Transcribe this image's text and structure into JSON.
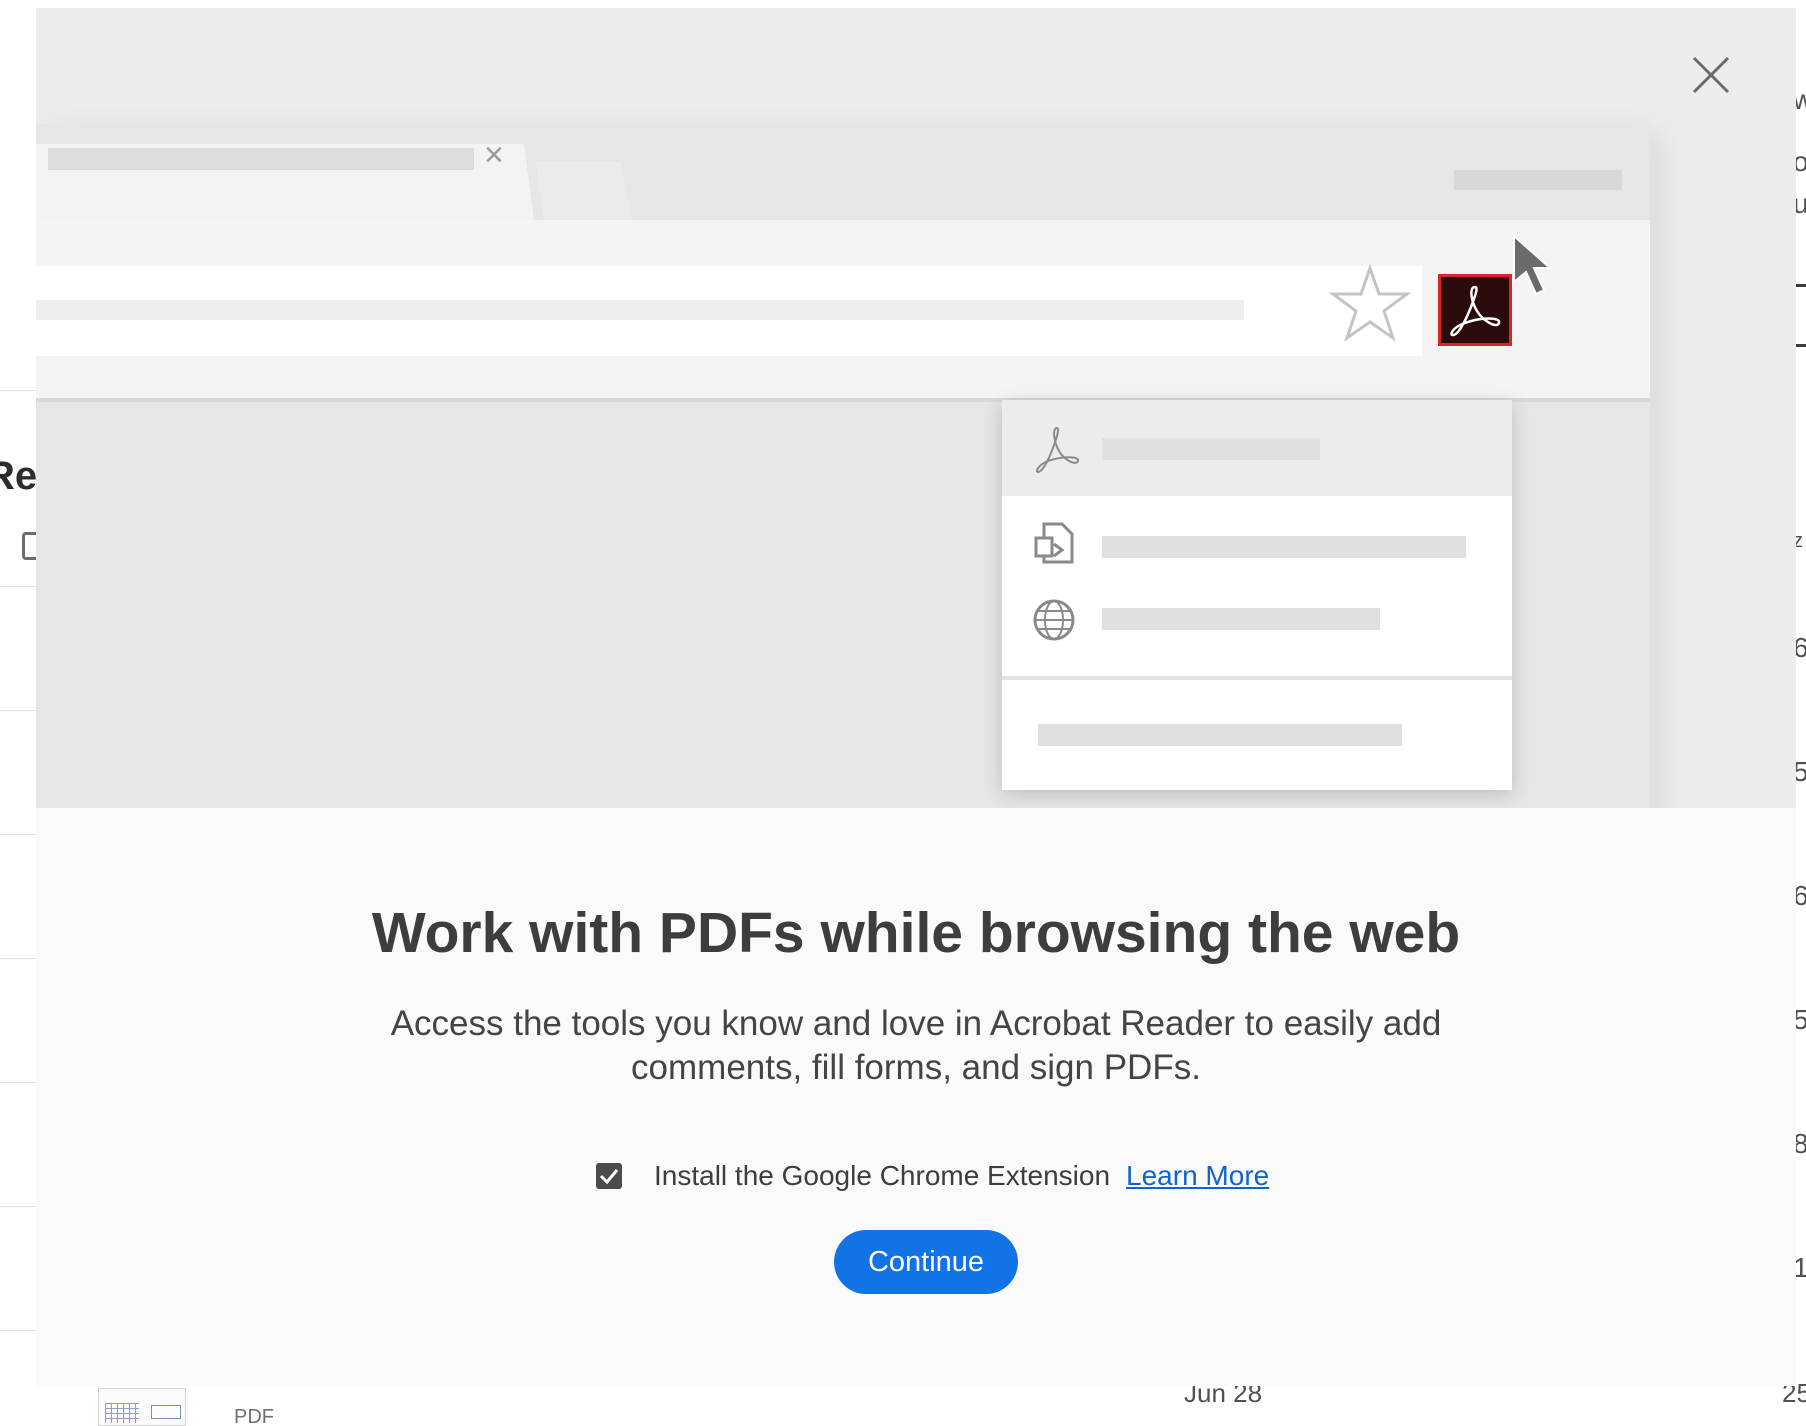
{
  "background": {
    "heading_fragment": "Rec",
    "right_edge_chars": [
      "w",
      "o",
      "u",
      "z",
      "6",
      "5",
      "6",
      "5",
      "8",
      "1"
    ],
    "bottom_row": {
      "file_type": "PDF",
      "date": "Jun 28",
      "size_fragment": "25"
    }
  },
  "modal": {
    "close_icon": "close-icon",
    "illustration": {
      "tab_close_glyph": "×",
      "star_icon": "star-icon",
      "acrobat_icon": "acrobat-icon",
      "acrobat_button_color": "#d9252a",
      "menu_icons": [
        "acrobat-outline-icon",
        "convert-icon",
        "globe-icon"
      ]
    },
    "title": "Work with PDFs while browsing the web",
    "description": "Access the tools you know and love in Acrobat Reader to easily add comments, fill forms, and sign PDFs.",
    "option": {
      "checked": true,
      "label": "Install the Google Chrome Extension",
      "learn_more": "Learn More"
    },
    "continue_label": "Continue",
    "accent_color": "#1273e6"
  }
}
